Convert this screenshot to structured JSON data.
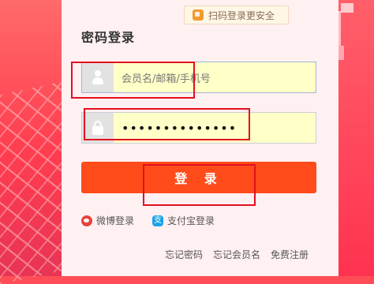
{
  "qr_tip": {
    "text": "扫码登录更安全",
    "icon": "shield-icon"
  },
  "title": "密码登录",
  "username": {
    "placeholder": "会员名/邮箱/手机号",
    "icon": "user-icon"
  },
  "password": {
    "value": "••••••••••••••",
    "icon": "lock-icon"
  },
  "login_button": {
    "label": "登 录"
  },
  "social": {
    "weibo": "微博登录",
    "alipay": "支付宝登录",
    "alipay_glyph": "支"
  },
  "links": {
    "forgot_password": "忘记密码",
    "forgot_member": "忘记会员名",
    "register": "免费注册"
  },
  "colors": {
    "accent": "#ff4c1a",
    "panel": "#fff0f2",
    "annotation": "#e20f1f"
  }
}
